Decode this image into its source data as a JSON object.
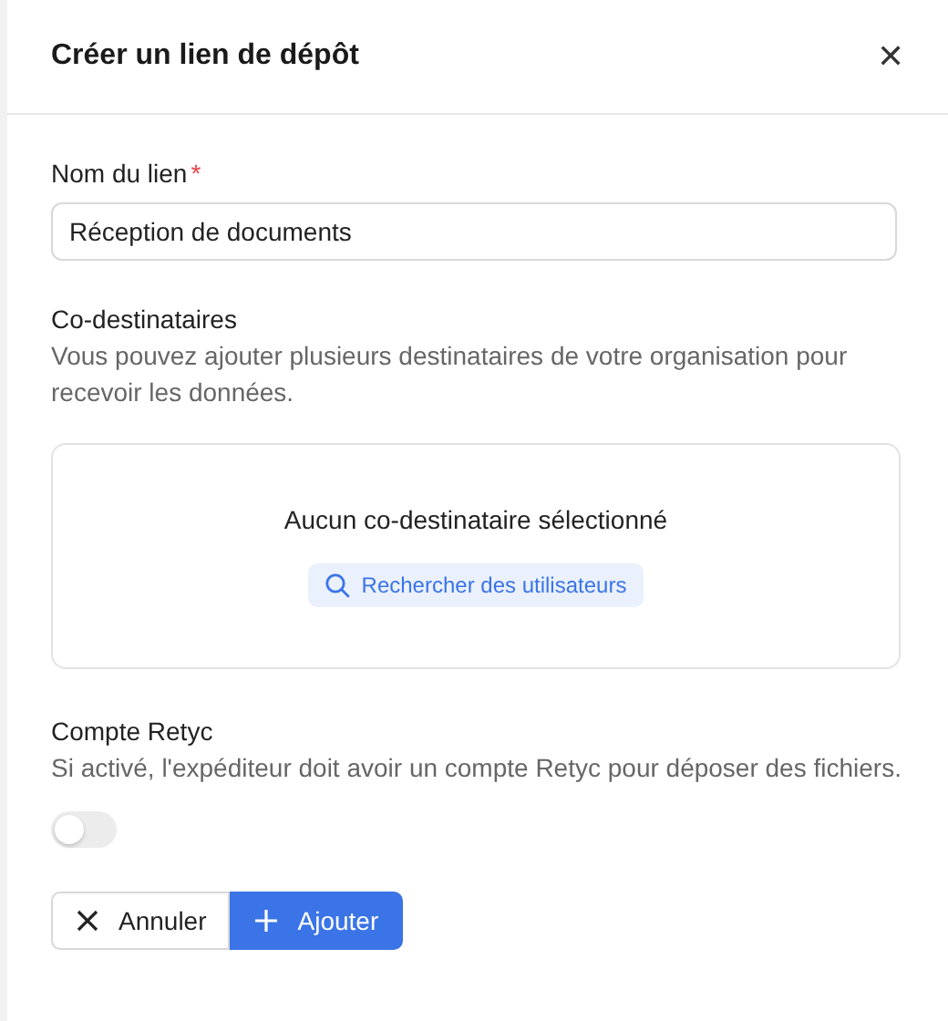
{
  "dialog": {
    "title": "Créer un lien de dépôt",
    "close_label": "✕"
  },
  "name_field": {
    "label": "Nom du lien",
    "required": true,
    "required_mark": "*",
    "value": "Réception de documents"
  },
  "co_recipients": {
    "label": "Co-destinataires",
    "description": "Vous pouvez ajouter plusieurs destinataires de votre organisation pour recevoir les données.",
    "empty_text": "Aucun co-destinataire sélectionné",
    "search_button": "Rechercher des utilisateurs"
  },
  "account": {
    "label": "Compte Retyc",
    "description": "Si activé, l'expéditeur doit avoir un compte Retyc pour déposer des fichiers.",
    "on": false
  },
  "buttons": [
    {
      "kind": "cancel",
      "label": "Annuler"
    },
    {
      "kind": "add",
      "label": "Ajouter"
    }
  ]
}
